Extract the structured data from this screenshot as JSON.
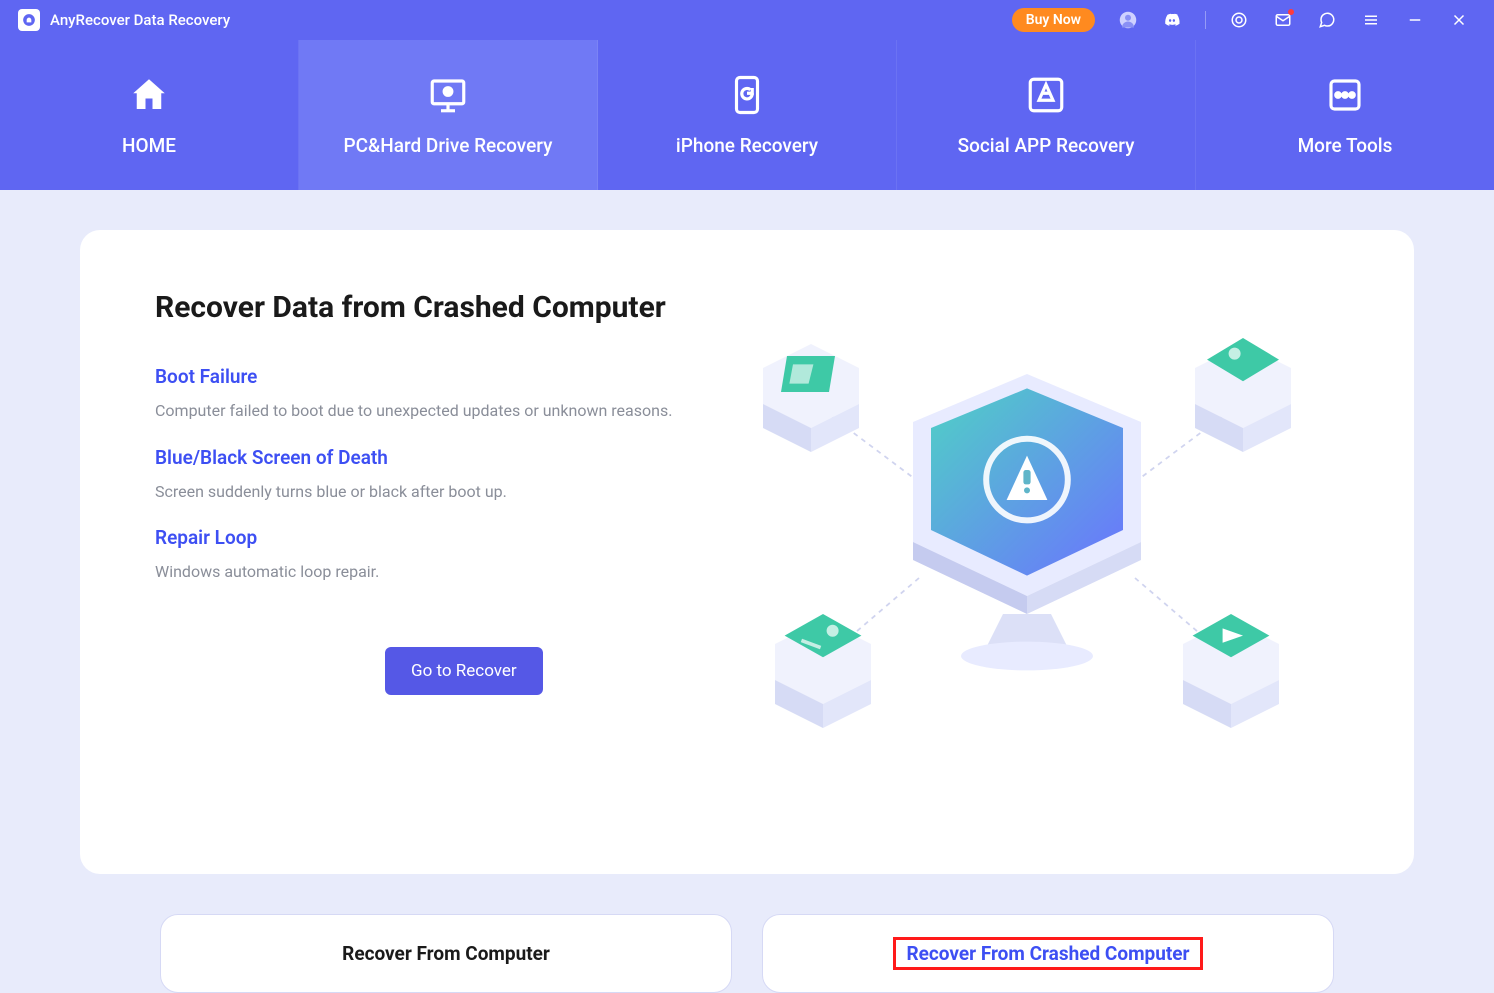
{
  "titlebar": {
    "app_title": "AnyRecover Data Recovery",
    "buy_now": "Buy Now"
  },
  "nav": {
    "items": [
      {
        "label": "HOME"
      },
      {
        "label": "PC&Hard Drive Recovery",
        "active": true
      },
      {
        "label": "iPhone Recovery"
      },
      {
        "label": "Social APP Recovery"
      },
      {
        "label": "More Tools"
      }
    ]
  },
  "card": {
    "title": "Recover Data from Crashed Computer",
    "sections": [
      {
        "heading": "Boot Failure",
        "desc": "Computer failed to boot due to unexpected updates or unknown reasons."
      },
      {
        "heading": "Blue/Black Screen of Death",
        "desc": "Screen suddenly turns blue or black after boot up."
      },
      {
        "heading": "Repair Loop",
        "desc": "Windows automatic loop repair."
      }
    ],
    "go_button": "Go to Recover"
  },
  "bottom": {
    "left": "Recover From Computer",
    "right": "Recover From Crashed Computer"
  },
  "colors": {
    "primary": "#5f66f2",
    "accent_orange": "#ff8a1f",
    "link_blue": "#3d4ff3",
    "highlight_red": "#ff1a1a"
  }
}
